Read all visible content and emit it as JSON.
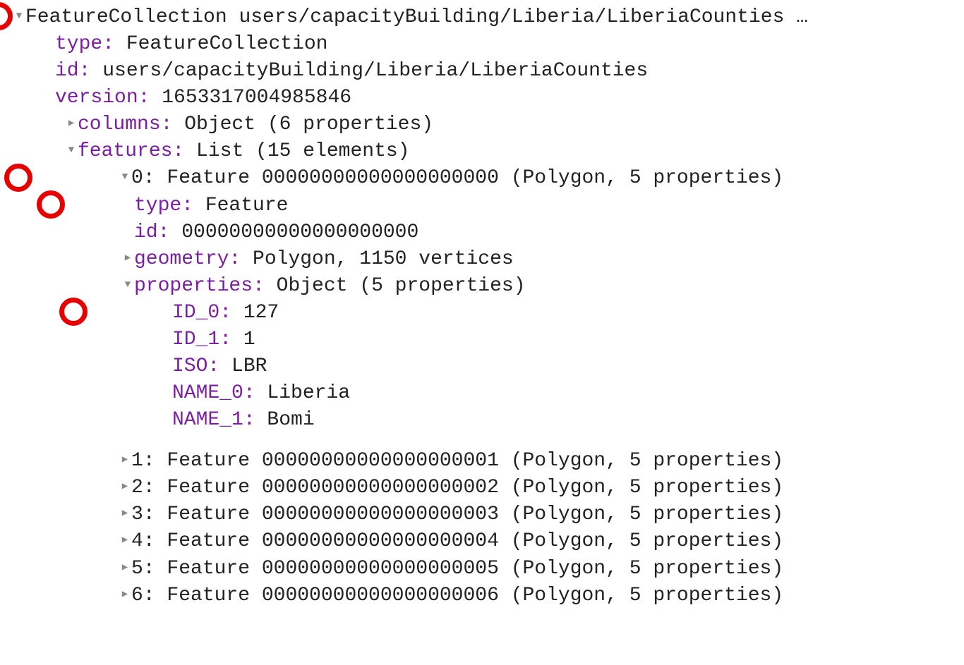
{
  "root": {
    "header": "FeatureCollection users/capacityBuilding/Liberia/LiberiaCounties …",
    "type_key": "type:",
    "type_val": " FeatureCollection",
    "id_key": "id:",
    "id_val": " users/capacityBuilding/Liberia/LiberiaCounties",
    "version_key": "version:",
    "version_val": " 1653317004985846",
    "columns_key": "columns:",
    "columns_val": " Object (6 properties)",
    "features_key": "features:",
    "features_val": " List (15 elements)"
  },
  "feature0": {
    "idx": "0:",
    "header": " Feature 00000000000000000000 (Polygon, 5 properties)",
    "type_key": "type:",
    "type_val": " Feature",
    "id_key": "id:",
    "id_val": " 00000000000000000000",
    "geometry_key": "geometry:",
    "geometry_val": " Polygon, 1150 vertices",
    "properties_key": "properties:",
    "properties_val": " Object (5 properties)"
  },
  "props": {
    "id0_key": "ID_0:",
    "id0_val": " 127",
    "id1_key": "ID_1:",
    "id1_val": " 1",
    "iso_key": "ISO:",
    "iso_val": " LBR",
    "name0_key": "NAME_0:",
    "name0_val": " Liberia",
    "name1_key": "NAME_1:",
    "name1_val": " Bomi"
  },
  "features_rest": [
    {
      "idx": "1:",
      "label": " Feature 00000000000000000001 (Polygon, 5 properties)"
    },
    {
      "idx": "2:",
      "label": " Feature 00000000000000000002 (Polygon, 5 properties)"
    },
    {
      "idx": "3:",
      "label": " Feature 00000000000000000003 (Polygon, 5 properties)"
    },
    {
      "idx": "4:",
      "label": " Feature 00000000000000000004 (Polygon, 5 properties)"
    },
    {
      "idx": "5:",
      "label": " Feature 00000000000000000005 (Polygon, 5 properties)"
    },
    {
      "idx": "6:",
      "label": " Feature 00000000000000000006 (Polygon, 5 properties)"
    }
  ]
}
